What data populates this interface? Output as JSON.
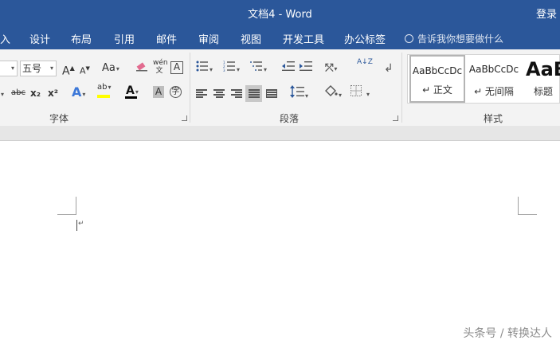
{
  "window": {
    "title": "文档4  -  Word",
    "login": "登录"
  },
  "tabs": [
    {
      "label": "入"
    },
    {
      "label": "设计"
    },
    {
      "label": "布局"
    },
    {
      "label": "引用"
    },
    {
      "label": "邮件"
    },
    {
      "label": "审阅"
    },
    {
      "label": "视图"
    },
    {
      "label": "开发工具"
    },
    {
      "label": "办公标签"
    }
  ],
  "tell_me": {
    "placeholder": "告诉我你想要做什么",
    "icon": "lightbulb-icon"
  },
  "font_group": {
    "label": "字体",
    "font_size": "五号",
    "grow_icon": "A",
    "shrink_icon": "A",
    "case_label": "Aa",
    "phonetic_label": "wén文",
    "border_char": "A",
    "strike_label": "abc",
    "sub_label": "x₂",
    "sup_label": "x²",
    "effects_label": "A",
    "highlight_label": "ab",
    "color_label": "A",
    "shade_label": "A",
    "encircle_label": "字",
    "colors": {
      "highlight": "#ffff00",
      "font": "#000000"
    }
  },
  "paragraph_group": {
    "label": "段落",
    "sort_label": "A↓Z"
  },
  "styles_group": {
    "label": "样式",
    "items": [
      {
        "preview": "AaBbCcDc",
        "name": "↵ 正文"
      },
      {
        "preview": "AaBbCcDc",
        "name": "↵ 无间隔"
      },
      {
        "preview": "AaB",
        "name": "标题"
      }
    ]
  },
  "watermark": "头条号 / 转换达人",
  "colors": {
    "title_bar": "#2b579a",
    "ribbon": "#f3f3f3"
  }
}
